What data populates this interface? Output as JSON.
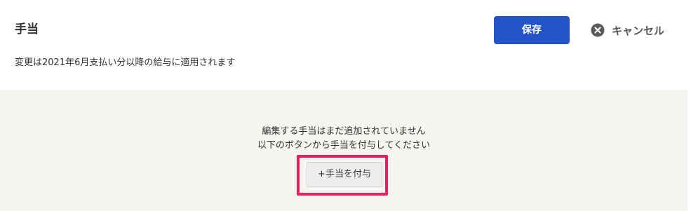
{
  "header": {
    "title": "手当",
    "notice": "変更は2021年6月支払い分以降の給与に適用されます",
    "save_label": "保存",
    "cancel_label": "キャンセル"
  },
  "empty_state": {
    "line1": "編集する手当はまだ追加されていません",
    "line2": "以下のボタンから手当を付与してください",
    "add_button_label": "+手当を付与"
  },
  "colors": {
    "primary": "#2353c7",
    "highlight": "#e8205e",
    "panel_bg": "#f6f5f2"
  },
  "icons": {
    "cancel": "close-circle-icon"
  }
}
